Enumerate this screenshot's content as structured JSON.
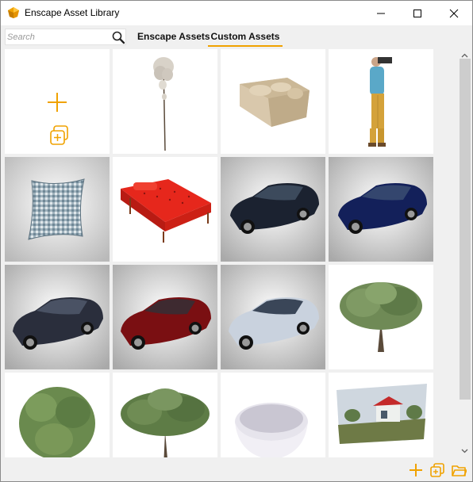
{
  "window": {
    "title": "Enscape Asset Library",
    "accent_color": "#f0a200"
  },
  "titlebar_buttons": [
    "minimize-icon",
    "maximize-icon",
    "close-icon"
  ],
  "toolbar": {
    "search_placeholder": "Search",
    "tabs": [
      {
        "label": "Enscape Assets",
        "active": false
      },
      {
        "label": "Custom Assets",
        "active": true
      }
    ]
  },
  "grid": {
    "tiles": [
      {
        "content": "add-asset",
        "icon": "plus-icon"
      },
      {
        "content": "tall-tree"
      },
      {
        "content": "sofa"
      },
      {
        "content": "person-with-camera"
      },
      {
        "content": "checkered-cushion"
      },
      {
        "content": "red-daybed"
      },
      {
        "content": "car-black"
      },
      {
        "content": "car-blue"
      },
      {
        "content": "car-dark-gray"
      },
      {
        "content": "car-red"
      },
      {
        "content": "car-silver"
      },
      {
        "content": "olive-tree"
      },
      {
        "content": "shrub-tree"
      },
      {
        "content": "spreading-tree"
      },
      {
        "content": "bathtub"
      },
      {
        "content": "house-panorama"
      }
    ]
  },
  "bottom_actions": [
    "add-icon",
    "add-from-file-icon",
    "open-folder-icon"
  ]
}
